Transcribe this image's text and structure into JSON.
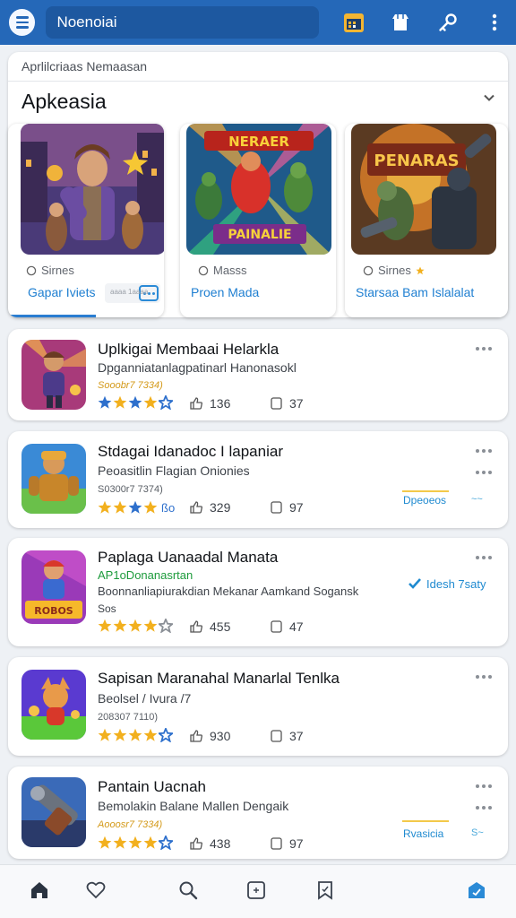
{
  "search": {
    "value": "Noenoiai"
  },
  "featured": {
    "breadcrumb": "Aprlilcriaas Nemaasan",
    "title": "Apkeasia",
    "cards": [
      {
        "meta": "Sirnes",
        "action": "Gapar Iviets",
        "chip": "aaaa 1aaaa"
      },
      {
        "meta": "Masss",
        "action": "Proen Mada"
      },
      {
        "meta": "Sirnes",
        "action": "Starsaa Bam Islalalat"
      }
    ]
  },
  "list": [
    {
      "title": "Uplkigai Membaai Helarkla",
      "subtitle": "Dpganniatanlagpatinarl Hanonasokl",
      "code": "Sooobr7 7334)",
      "rating": 4.5,
      "likes": "136",
      "comments": "37"
    },
    {
      "title": "Stdagai Idanadoc I lapaniar",
      "subtitle": "Peoasitlin Flagian Onionies",
      "code": "S0300r7 7374)",
      "rating_text": "ßo",
      "rating": 3.5,
      "likes": "329",
      "comments": "97",
      "side_link": "Dpeoeos"
    },
    {
      "title": "Paplaga Uanaadal Manata",
      "code": "AP1oDonanasrtan",
      "subtitle": "Boonnanliapiurakdian Mekanar Aamkand Sogansk",
      "subtitle2": "Sos",
      "rating": 3.5,
      "likes": "455",
      "comments": "47",
      "side_link": "Idesh 7saty"
    },
    {
      "title": "Sapisan Maranahal Manarlal Tenlka",
      "subtitle": "Beolsel / Ivura /7",
      "code": "208307 7110)",
      "rating": 4.5,
      "likes": "930",
      "comments": "37"
    },
    {
      "title": "Pantain Uacnah",
      "subtitle": "Bemolakin Balane Mallen Dengaik",
      "code": "Aooosr7 7334)",
      "rating": 4.5,
      "likes": "438",
      "comments": "97",
      "side_link": "Rvasicia"
    }
  ],
  "icons": {
    "appbar": [
      "menu-icon",
      "calendar-icon",
      "shop-icon",
      "key-icon",
      "more-vertical-icon"
    ],
    "bottom_nav": [
      "home-icon",
      "heart-icon",
      "search-icon",
      "puzzle-icon",
      "bookmark-icon",
      "store-icon"
    ]
  },
  "colors": {
    "primary": "#2568b8",
    "accent": "#1f7fd1",
    "star": "#f2b01e",
    "star_blue": "#2d6fcc"
  }
}
